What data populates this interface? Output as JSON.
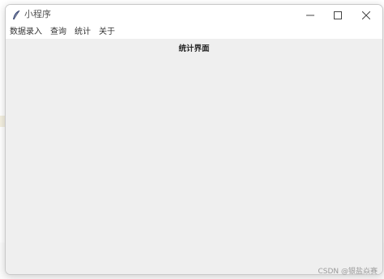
{
  "window": {
    "title": "小程序",
    "app_icon": "feather-icon"
  },
  "menu": {
    "items": [
      {
        "label": "数据录入"
      },
      {
        "label": "查询"
      },
      {
        "label": "统计"
      },
      {
        "label": "关于"
      }
    ]
  },
  "content": {
    "heading": "统计界面"
  },
  "watermark": "CSDN @银盐焱赛",
  "colors": {
    "content_bg": "#efefef",
    "titlebar_bg": "#ffffff",
    "text": "#333333"
  }
}
